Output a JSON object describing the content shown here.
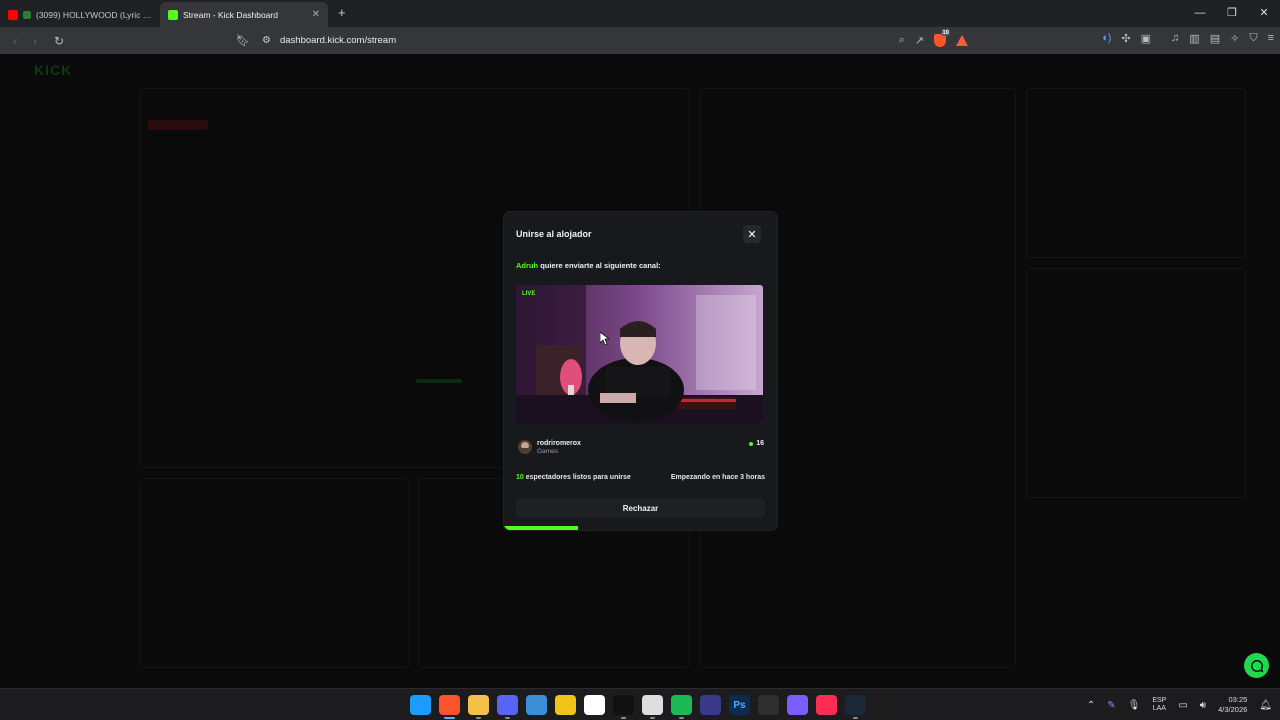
{
  "browser": {
    "tabs": [
      {
        "title": "(3099) HOLLYWOOD (Lyric Video)",
        "favicon_color": "#ff0000",
        "active": false
      },
      {
        "title": "Stream - Kick Dashboard",
        "favicon_color": "#53fc18",
        "active": true
      }
    ],
    "url": "dashboard.kick.com/stream"
  },
  "modal": {
    "title": "Unirse al alojador",
    "host_user": "Adruh",
    "message_rest": "quiere enviarte al siguiente canal:",
    "live_badge": "LIVE",
    "channel_name": "rodriromerox",
    "channel_category": "Games",
    "channel_viewers": "16",
    "ready_count": "10",
    "ready_text": "espectadores listos para unirse",
    "start_text": "Empezando en hace 3 horas",
    "reject_label": "Rechazar",
    "countdown_progress": 0.27,
    "accent_color": "#53fc18"
  },
  "taskbar": {
    "apps": [
      {
        "name": "windows-start-icon",
        "label": "",
        "color": "#1e9bff"
      },
      {
        "name": "brave-browser-icon",
        "label": "",
        "color": "#fb542b"
      },
      {
        "name": "file-explorer-icon",
        "label": "",
        "color": "#f5c04a"
      },
      {
        "name": "discord-icon",
        "label": "",
        "color": "#5865f2"
      },
      {
        "name": "photos-icon",
        "label": "",
        "color": "#3b8fd6"
      },
      {
        "name": "app-yellow-icon",
        "label": "",
        "color": "#f0c419"
      },
      {
        "name": "capcut-icon",
        "label": "",
        "color": "#ffffff"
      },
      {
        "name": "tiktok-icon",
        "label": "",
        "color": "#111111"
      },
      {
        "name": "chrome-icon",
        "label": "",
        "color": "#dddddd"
      },
      {
        "name": "spotify-icon",
        "label": "",
        "color": "#1db954"
      },
      {
        "name": "obs-icon",
        "label": "",
        "color": "#3a3a8a"
      },
      {
        "name": "photoshop-icon",
        "label": "Ps",
        "color": "#0d2b4d"
      },
      {
        "name": "terminal-icon",
        "label": "",
        "color": "#2f2f2f"
      },
      {
        "name": "settings-gear-icon",
        "label": "",
        "color": "#7a5cff"
      },
      {
        "name": "tiktok-live-icon",
        "label": "",
        "color": "#fe2c55"
      },
      {
        "name": "steam-icon",
        "label": "",
        "color": "#1b2838"
      }
    ],
    "lang_top": "ESP",
    "lang_bottom": "LAA",
    "time": "03:25",
    "date": "4/3/2026"
  }
}
